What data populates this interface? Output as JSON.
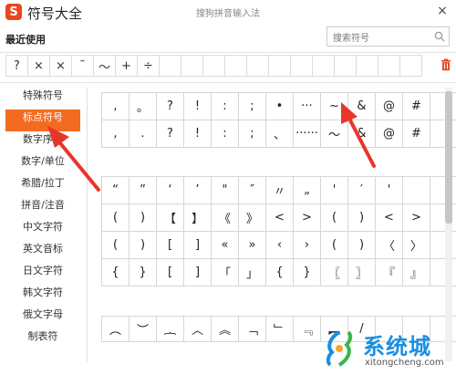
{
  "titlebar": {
    "logo_letter": "S",
    "app_title": "符号大全",
    "window_title": "搜狗拼音输入法",
    "close_glyph": "×"
  },
  "recent": {
    "label": "最近使用",
    "items": [
      "?",
      "×",
      "×",
      "˜",
      "～",
      "+",
      "÷",
      "",
      "",
      "",
      "",
      "",
      "",
      "",
      "",
      "",
      "",
      "",
      ""
    ]
  },
  "search": {
    "placeholder": "搜索符号"
  },
  "sidebar": {
    "items": [
      {
        "label": "特殊符号",
        "active": false
      },
      {
        "label": "标点符号",
        "active": true
      },
      {
        "label": "数字序号",
        "active": false
      },
      {
        "label": "数字/单位",
        "active": false
      },
      {
        "label": "希腊/拉丁",
        "active": false
      },
      {
        "label": "拼音/注音",
        "active": false
      },
      {
        "label": "中文字符",
        "active": false
      },
      {
        "label": "英文音标",
        "active": false
      },
      {
        "label": "日文字符",
        "active": false
      },
      {
        "label": "韩文字符",
        "active": false
      },
      {
        "label": "俄文字母",
        "active": false
      },
      {
        "label": "制表符",
        "active": false
      }
    ]
  },
  "grid1": [
    ",",
    "。",
    "?",
    "!",
    ":",
    ";",
    "•",
    "···",
    "~",
    "&",
    "@",
    "#",
    "",
    ",",
    ".",
    "?",
    "!",
    ":",
    ";",
    "、",
    "······",
    "～",
    "&",
    "@",
    "#",
    ""
  ],
  "grid2": [
    "“",
    "”",
    "‘",
    "’",
    "\"",
    "″",
    "〃",
    "„",
    "'",
    "′",
    "'",
    "",
    "",
    "(",
    ")",
    "【",
    "】",
    "《",
    "》",
    "<",
    ">",
    "(",
    ")",
    "<",
    ">",
    "",
    "(",
    ")",
    "[",
    "]",
    "«",
    "»",
    "‹",
    "›",
    "(",
    ")",
    "〈",
    "〉",
    "",
    "{",
    "}",
    "[",
    "]",
    "「",
    "」",
    "{",
    "}",
    "〖",
    "〗",
    "『",
    "』",
    ""
  ],
  "grid3": [
    "︵",
    "︶",
    "︷",
    "︿",
    "︽",
    "﹁",
    "﹂",
    "﹃",
    "︻",
    "/",
    "",
    "",
    ""
  ],
  "watermark": {
    "text": "系统城",
    "url": "xitongcheng.com"
  }
}
